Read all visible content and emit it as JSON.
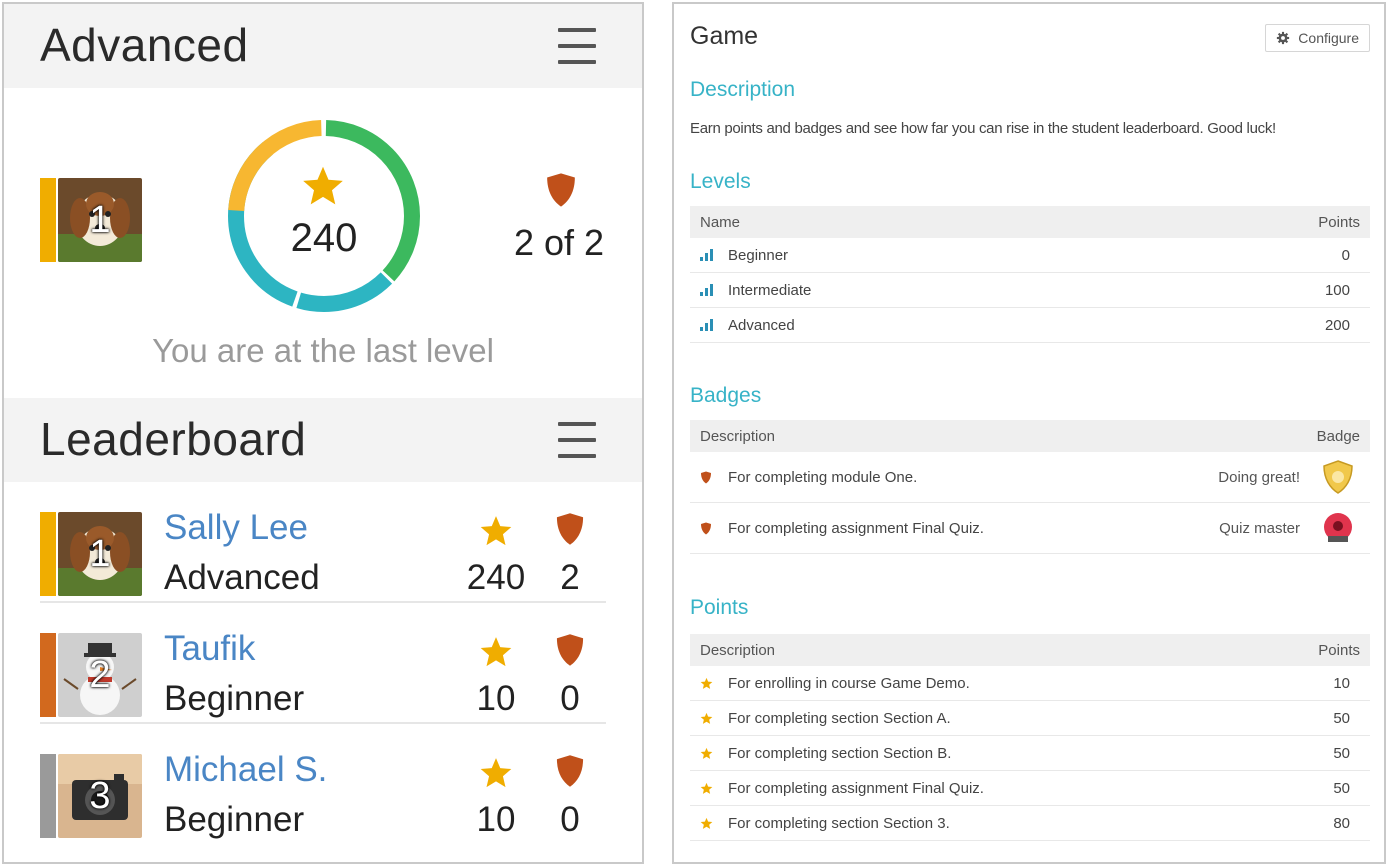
{
  "advanced_block": {
    "title": "Advanced",
    "menu_icon": "hamburger-menu-icon",
    "rank": "1",
    "rank_color": "#f0ad00",
    "points": "240",
    "points_progress": 1.0,
    "ring_colors": [
      "#2db5c2",
      "#3cb95e",
      "#f7b731"
    ],
    "badges_label": "2 of 2",
    "message": "You are at the last level"
  },
  "leaderboard": {
    "title": "Leaderboard",
    "menu_icon": "hamburger-menu-icon",
    "rows": [
      {
        "rank": "1",
        "rank_color": "#f0ad00",
        "name": "Sally Lee",
        "level": "Advanced",
        "points": "240",
        "badges": "2",
        "avatar": "puppy"
      },
      {
        "rank": "2",
        "rank_color": "#d2691e",
        "name": "Taufik",
        "level": "Beginner",
        "points": "10",
        "badges": "0",
        "avatar": "snowman"
      },
      {
        "rank": "3",
        "rank_color": "#9a9a9a",
        "name": "Michael S.",
        "level": "Beginner",
        "points": "10",
        "badges": "0",
        "avatar": "camera"
      }
    ]
  },
  "game": {
    "title": "Game",
    "configure_label": "Configure",
    "description_heading": "Description",
    "description_text": "Earn points and badges and see how far you can rise in the student leaderboard. Good luck!",
    "levels_heading": "Levels",
    "levels_columns": [
      "Name",
      "Points"
    ],
    "levels": [
      {
        "name": "Beginner",
        "points": "0"
      },
      {
        "name": "Intermediate",
        "points": "100"
      },
      {
        "name": "Advanced",
        "points": "200"
      }
    ],
    "badges_heading": "Badges",
    "badges_columns": [
      "Description",
      "Badge"
    ],
    "badges": [
      {
        "description": "For completing module One.",
        "badge_name": "Doing great!",
        "badge_color": "#f1c84b"
      },
      {
        "description": "For completing assignment Final Quiz.",
        "badge_name": "Quiz master",
        "badge_color": "#e0344d"
      }
    ],
    "points_heading": "Points",
    "points_columns": [
      "Description",
      "Points"
    ],
    "points": [
      {
        "description": "For enrolling in course Game Demo.",
        "points": "10"
      },
      {
        "description": "For completing section Section A.",
        "points": "50"
      },
      {
        "description": "For completing section Section B.",
        "points": "50"
      },
      {
        "description": "For completing assignment Final Quiz.",
        "points": "50"
      },
      {
        "description": "For completing section Section 3.",
        "points": "80"
      }
    ]
  },
  "colors": {
    "star": "#f0ad00",
    "shield": "#c0501a",
    "accent": "#37b3c7",
    "link": "#4a86c5",
    "level_icon": "#2a8fb5"
  }
}
